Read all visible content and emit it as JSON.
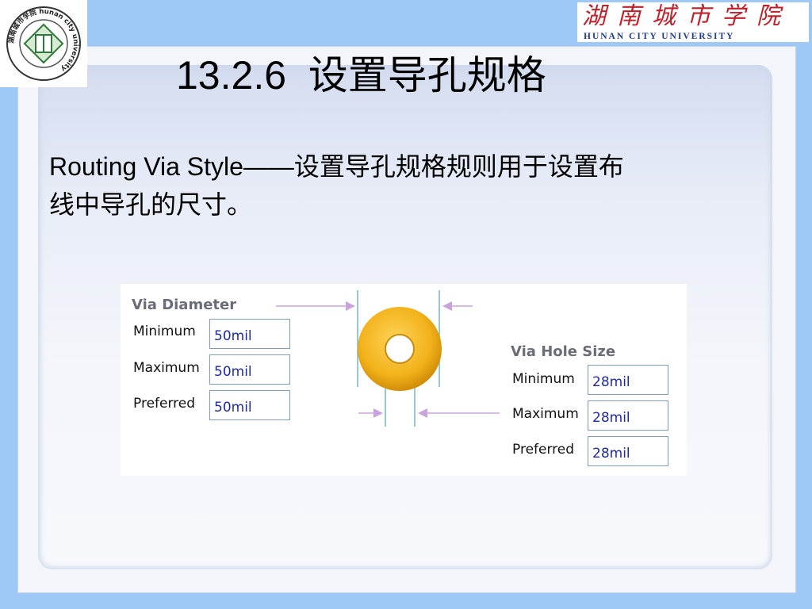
{
  "logo_left": {
    "ring_text": "湖南城市学院 hunan city university"
  },
  "logo_right": {
    "chinese": "湖南城市学院",
    "english": "HUNAN CITY UNIVERSITY"
  },
  "title": "13.2.6  设置导孔规格",
  "body": {
    "line1": "Routing Via Style——设置导孔规格规则用于设置布",
    "line2": "线中导孔的尺寸。"
  },
  "via_diameter": {
    "title": "Via Diameter",
    "fields": [
      {
        "label": "Minimum",
        "value": "50mil"
      },
      {
        "label": "Maximum",
        "value": "50mil"
      },
      {
        "label": "Preferred",
        "value": "50mil"
      }
    ]
  },
  "via_hole_size": {
    "title": "Via Hole Size",
    "fields": [
      {
        "label": "Minimum",
        "value": "28mil"
      },
      {
        "label": "Maximum",
        "value": "28mil"
      },
      {
        "label": "Preferred",
        "value": "28mil"
      }
    ]
  },
  "colors": {
    "background": "#9ec9f7",
    "via_pad": "#f2b21a",
    "dimension_line": "#c9a4dc",
    "guide_line": "#6fb9c6",
    "input_text": "#1f2aa6"
  },
  "icons": [
    "university-emblem-icon",
    "via-pad-icon",
    "arrow-right-icon",
    "arrow-left-icon"
  ]
}
